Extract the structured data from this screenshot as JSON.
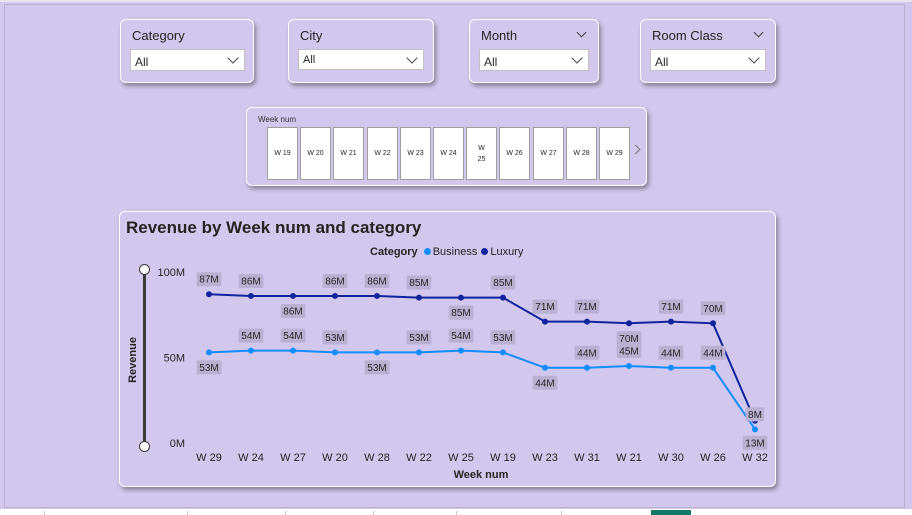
{
  "filters": {
    "category": {
      "label": "Category",
      "value": "All"
    },
    "city": {
      "label": "City",
      "value": "All"
    },
    "month": {
      "label": "Month",
      "value": "All"
    },
    "room_class": {
      "label": "Room Class",
      "value": "All"
    }
  },
  "week_slicer": {
    "label": "Week num",
    "tiles": [
      "W 19",
      "W 20",
      "W 21",
      "W 22",
      "W 23",
      "W 24",
      "W\n25",
      "W 26",
      "W 27",
      "W 28",
      "W 29"
    ]
  },
  "chart": {
    "title": "Revenue by Week num and category",
    "legend_title": "Category"
  },
  "chart_data": {
    "type": "line",
    "title": "Revenue by Week num and category",
    "xlabel": "Week num",
    "ylabel": "Revenue",
    "categories": [
      "W 29",
      "W 24",
      "W 27",
      "W 20",
      "W 28",
      "W 22",
      "W 25",
      "W 19",
      "W 23",
      "W 31",
      "W 21",
      "W 30",
      "W 26",
      "W 32"
    ],
    "yticks": [
      "0M",
      "50M",
      "100M"
    ],
    "ylim": [
      0,
      100
    ],
    "legend_position": "top-center",
    "series": [
      {
        "name": "Business",
        "color": "#118dff",
        "values": [
          53,
          54,
          54,
          53,
          53,
          53,
          54,
          53,
          44,
          44,
          45,
          44,
          44,
          8
        ],
        "labels": [
          "53M",
          "54M",
          "54M",
          "53M",
          "53M",
          "53M",
          "54M",
          "53M",
          "44M",
          "44M",
          "45M",
          "44M",
          "44M",
          "8M"
        ]
      },
      {
        "name": "Luxury",
        "color": "#12239e",
        "values": [
          87,
          86,
          86,
          86,
          86,
          85,
          85,
          85,
          71,
          71,
          70,
          71,
          70,
          13
        ],
        "labels": [
          "87M",
          "86M",
          "86M",
          "86M",
          "86M",
          "85M",
          "85M",
          "85M",
          "71M",
          "71M",
          "70M",
          "71M",
          "70M",
          "13M"
        ]
      }
    ]
  }
}
